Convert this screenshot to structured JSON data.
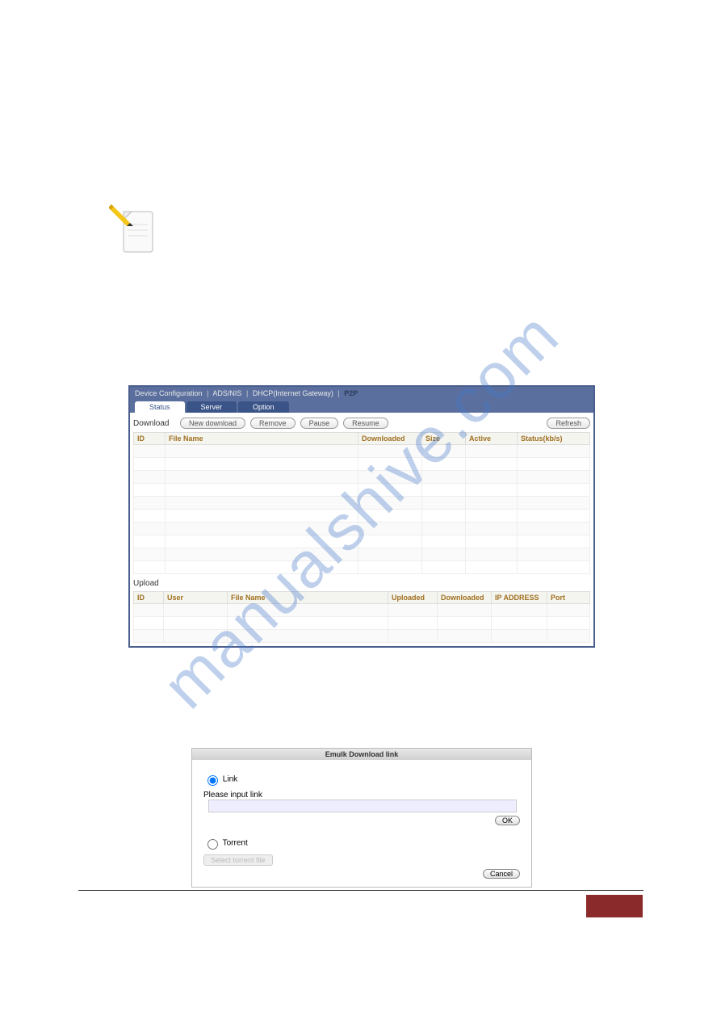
{
  "watermark": "manualshive.com",
  "router": {
    "breadcrumb": {
      "a": "Device Configuration",
      "b": "ADS/NIS",
      "c": "DHCP(Internet Gateway)",
      "d": "P2P"
    },
    "tabs": {
      "status": "Status",
      "server": "Server",
      "option": "Option"
    },
    "download": {
      "label": "Download",
      "buttons": {
        "new": "New download",
        "remove": "Remove",
        "pause": "Pause",
        "resume": "Resume",
        "refresh": "Refresh"
      },
      "headers": {
        "id": "ID",
        "filename": "File Name",
        "downloaded": "Downloaded",
        "size": "Size",
        "active": "Active",
        "status": "Status(kb/s)"
      }
    },
    "upload": {
      "label": "Upload",
      "headers": {
        "id": "ID",
        "user": "User",
        "filename": "File Name",
        "uploaded": "Uploaded",
        "downloaded": "Downloaded",
        "ip": "IP ADDRESS",
        "port": "Port"
      }
    }
  },
  "dialog": {
    "title": "Emulk Download link",
    "link_label": "Link",
    "prompt": "Please input link",
    "torrent_label": "Torrent",
    "select_file": "Select torrent file",
    "ok": "OK",
    "cancel": "Cancel"
  }
}
